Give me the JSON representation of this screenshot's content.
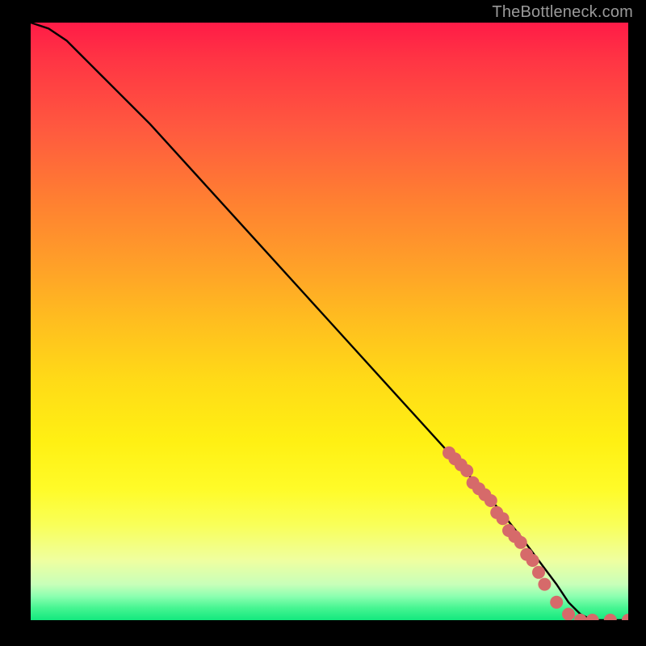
{
  "credit": "TheBottleneck.com",
  "colors": {
    "background": "#000000",
    "credit_text": "#9a9a9a",
    "curve": "#000000",
    "dot": "#d66a6a",
    "gradient_stops": [
      "#ff1b47",
      "#ff3444",
      "#ff5a3f",
      "#ff8031",
      "#ff9e29",
      "#ffbe1f",
      "#ffdb17",
      "#fff013",
      "#fffb28",
      "#f9ff58",
      "#efffa0",
      "#c8ffb9",
      "#8cffb0",
      "#45f591",
      "#13e87e"
    ]
  },
  "chart_data": {
    "type": "line",
    "title": "",
    "xlabel": "",
    "ylabel": "",
    "xlim": [
      0,
      100
    ],
    "ylim": [
      0,
      100
    ],
    "grid": false,
    "legend": false,
    "series": [
      {
        "name": "curve",
        "x": [
          0,
          3,
          6,
          8,
          10,
          12,
          15,
          20,
          30,
          40,
          50,
          60,
          70,
          78,
          82,
          85,
          88,
          90,
          92,
          94,
          96,
          98,
          100
        ],
        "y": [
          100,
          99,
          97,
          95,
          93,
          91,
          88,
          83,
          72,
          61,
          50,
          39,
          28,
          19,
          14,
          10,
          6,
          3,
          1,
          0,
          0,
          0,
          0
        ]
      }
    ],
    "highlight_points": {
      "name": "dots",
      "x": [
        70,
        71,
        72,
        73,
        74,
        75,
        76,
        77,
        78,
        79,
        80,
        81,
        82,
        83,
        84,
        85,
        86,
        88,
        90,
        92,
        94,
        97,
        100
      ],
      "y": [
        28,
        27,
        26,
        25,
        23,
        22,
        21,
        20,
        18,
        17,
        15,
        14,
        13,
        11,
        10,
        8,
        6,
        3,
        1,
        0,
        0,
        0,
        0
      ]
    }
  }
}
